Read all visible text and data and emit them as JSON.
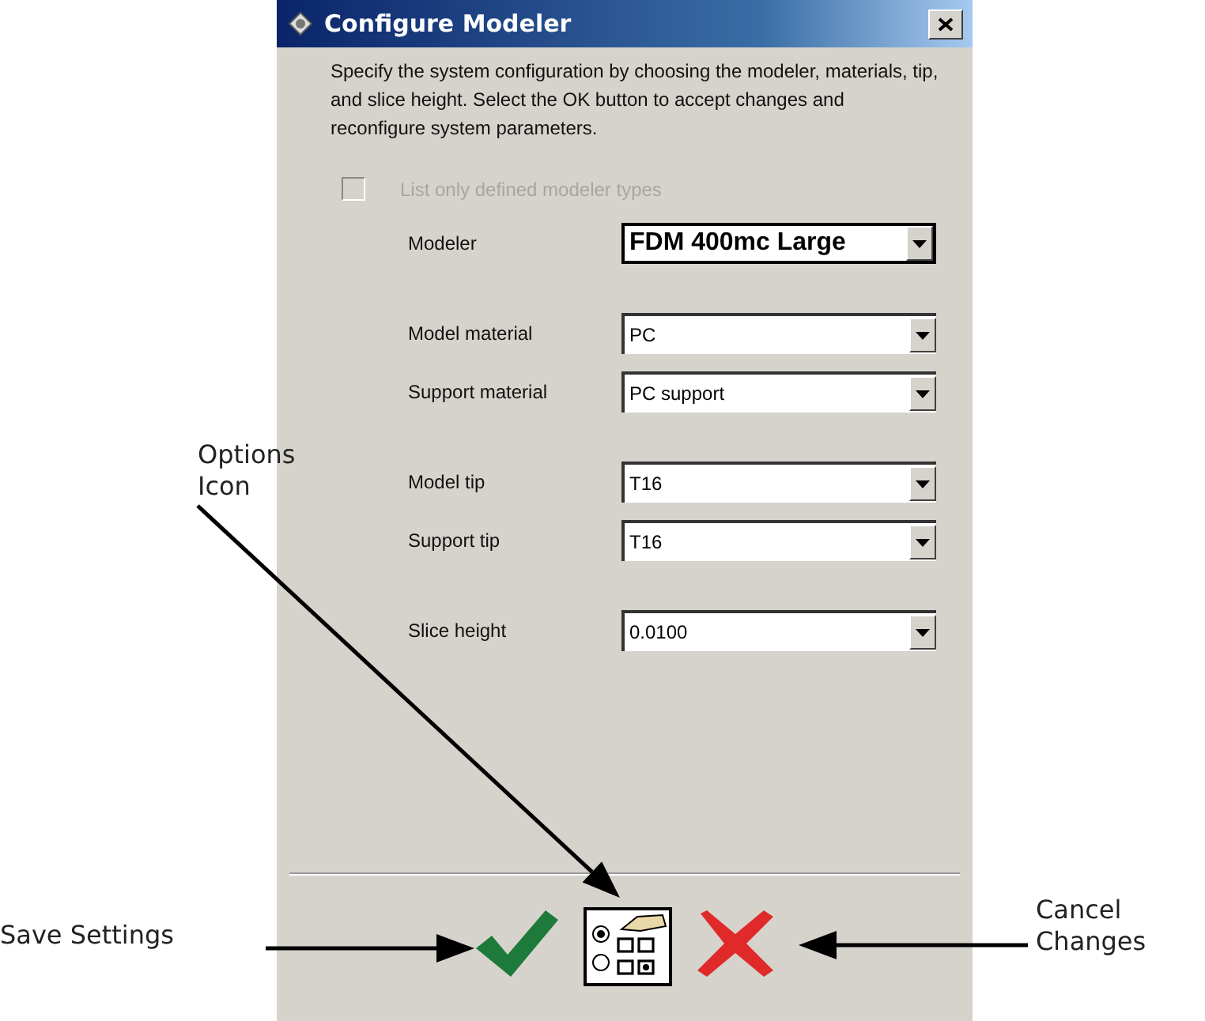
{
  "window": {
    "title": "Configure Modeler"
  },
  "description": "Specify the system configuration by choosing the modeler, materials, tip, and slice height.  Select the OK button to accept changes and reconfigure system parameters.",
  "option": {
    "label": "List only defined modeler types",
    "checked": false,
    "disabled": true
  },
  "field_groups": [
    [
      {
        "label": "Modeler",
        "value": "FDM 400mc Large",
        "kind": "bold"
      }
    ],
    [
      {
        "label": "Model material",
        "value": "PC",
        "kind": "plain"
      },
      {
        "label": "Support material",
        "value": "PC support",
        "kind": "plain"
      }
    ],
    [
      {
        "label": "Model tip",
        "value": "T16",
        "kind": "plain"
      },
      {
        "label": "Support tip",
        "value": "T16",
        "kind": "plain"
      }
    ],
    [
      {
        "label": "Slice height",
        "value": "0.0100",
        "kind": "plain"
      }
    ]
  ],
  "buttons": [
    {
      "kind": "save"
    },
    {
      "kind": "options"
    },
    {
      "kind": "cancel"
    }
  ],
  "callouts": [
    {
      "text": "Options Icon",
      "kind": "options"
    },
    {
      "text": "Save Settings",
      "kind": "save"
    },
    {
      "text": "Cancel Changes",
      "kind": "cancel"
    }
  ]
}
